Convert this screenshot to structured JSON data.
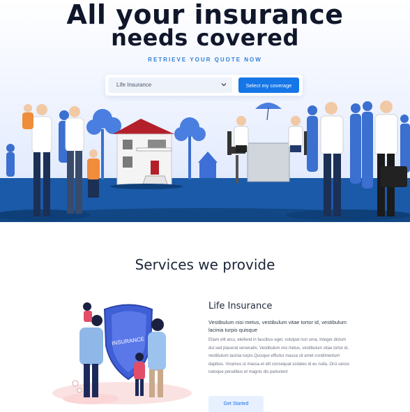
{
  "hero": {
    "title_line1": "All your insurance",
    "title_line2": "needs covered",
    "kicker": "RETRIEVE YOUR QUOTE NOW",
    "select_value": "Life Insurance",
    "cover_button": "Select my coverage"
  },
  "services": {
    "title": "Services we provide",
    "card": {
      "title": "Life Insurance",
      "subtitle": "Vestibulum nisi metus, vestibulum vitae tortor id, vestibulum lacinia turpis quisque",
      "body": "Etiam elit arcu, eleifend in faucibus eget, volutpat non urna. Integer dictum dui sed placerat venenatis. Vestibulum nisi metus, vestibulum vitae tortor id, vestibulum lacinia turpis.Quisque efficitur massa sit amet condimentum dapibus. Vivamus ut massa et elit consequat sodales id eu nulla. Orci varius natoque penatibus et magnis dis parturient",
      "shield_text": "INSURANCE",
      "button": "Get Started"
    }
  },
  "colors": {
    "accent": "#1576e8",
    "scene_blue": "#1e5fb4",
    "roof_red": "#b3202a",
    "dark_text": "#10172b"
  }
}
